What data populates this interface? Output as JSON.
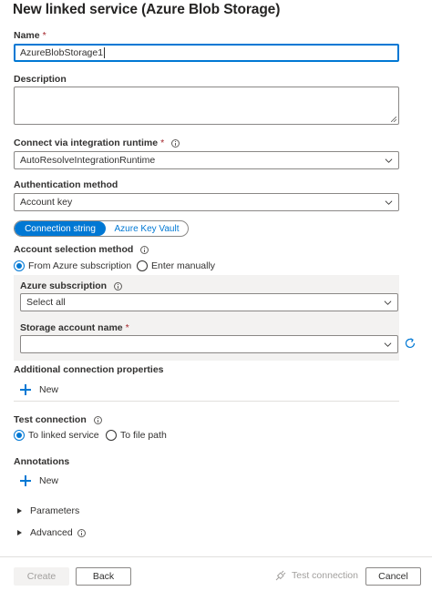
{
  "header": {
    "title": "New linked service (Azure Blob Storage)"
  },
  "name": {
    "label": "Name",
    "required": "*",
    "value": "AzureBlobStorage1"
  },
  "description": {
    "label": "Description",
    "value": ""
  },
  "integration_runtime": {
    "label": "Connect via integration runtime",
    "required": "*",
    "value": "AutoResolveIntegrationRuntime"
  },
  "auth_method": {
    "label": "Authentication method",
    "value": "Account key"
  },
  "connection_toggle": {
    "option_1": "Connection string",
    "option_2": "Azure Key Vault",
    "selected": "Connection string"
  },
  "account_selection": {
    "label": "Account selection method",
    "option_1": "From Azure subscription",
    "option_2": "Enter manually",
    "selected": "From Azure subscription"
  },
  "azure_subscription": {
    "label": "Azure subscription",
    "value": "Select all"
  },
  "storage_account": {
    "label": "Storage account name",
    "required": "*",
    "value": ""
  },
  "additional_props": {
    "label": "Additional connection properties",
    "new_label": "New"
  },
  "test_connection": {
    "label": "Test connection",
    "option_1": "To linked service",
    "option_2": "To file path",
    "selected": "To linked service"
  },
  "annotations": {
    "label": "Annotations",
    "new_label": "New"
  },
  "parameters": {
    "label": "Parameters"
  },
  "advanced": {
    "label": "Advanced"
  },
  "footer": {
    "create_label": "Create",
    "back_label": "Back",
    "test_connection_label": "Test connection",
    "cancel_label": "Cancel"
  },
  "colors": {
    "accent": "#0078d4",
    "required": "#a4262c",
    "text": "#323130",
    "disabled": "#a19f9d",
    "panel": "#f3f2f1"
  }
}
